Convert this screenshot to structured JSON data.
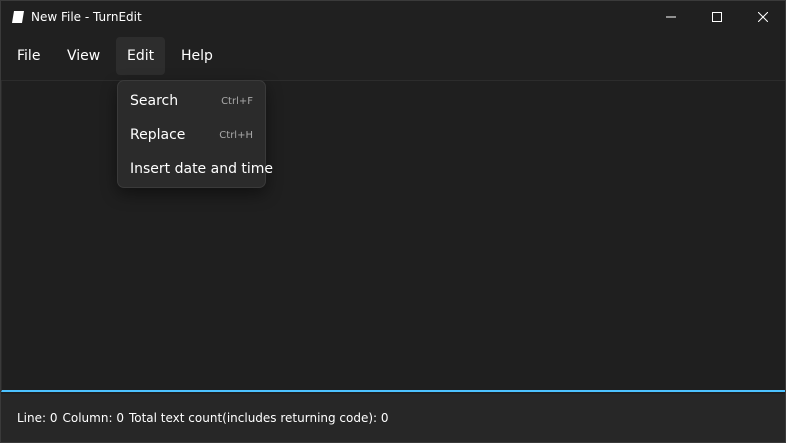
{
  "window": {
    "title": "New File - TurnEdit"
  },
  "menubar": {
    "items": [
      {
        "label": "File"
      },
      {
        "label": "View"
      },
      {
        "label": "Edit"
      },
      {
        "label": "Help"
      }
    ]
  },
  "edit_menu": {
    "items": [
      {
        "label": "Search",
        "shortcut": "Ctrl+F"
      },
      {
        "label": "Replace",
        "shortcut": "Ctrl+H"
      },
      {
        "label": "Insert date and time",
        "shortcut": ""
      }
    ]
  },
  "statusbar": {
    "line": "Line: 0",
    "column": "Column: 0",
    "total": "Total text count(includes returning code): 0"
  },
  "colors": {
    "background": "#202020",
    "accent": "#4cc2ff",
    "menu_bg": "#2b2b2b"
  }
}
